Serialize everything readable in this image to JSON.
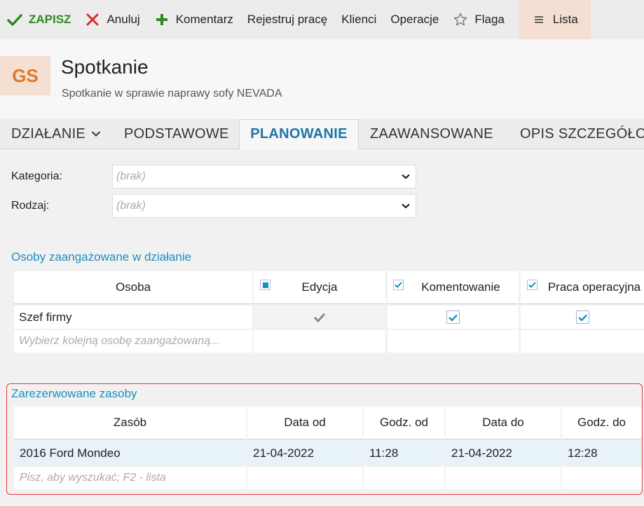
{
  "toolbar": {
    "save": "ZAPISZ",
    "cancel": "Anuluj",
    "comment": "Komentarz",
    "register_work": "Rejestruj pracę",
    "clients": "Klienci",
    "operations": "Operacje",
    "flag": "Flaga",
    "list": "Lista"
  },
  "header": {
    "avatar": "GS",
    "title": "Spotkanie",
    "subtitle": "Spotkanie w sprawie naprawy sofy NEVADA"
  },
  "tabs": [
    {
      "label": "DZIAŁANIE"
    },
    {
      "label": "PODSTAWOWE"
    },
    {
      "label": "PLANOWANIE"
    },
    {
      "label": "ZAAWANSOWANE"
    },
    {
      "label": "OPIS SZCZEGÓŁOWY"
    }
  ],
  "form": {
    "category_label": "Kategoria:",
    "category_value": "(brak)",
    "type_label": "Rodzaj:",
    "type_value": "(brak)"
  },
  "people": {
    "title": "Osoby zaangażowane w działanie",
    "columns": [
      "Osoba",
      "Edycja",
      "Komentowanie",
      "Praca operacyjna"
    ],
    "rows": [
      {
        "person": "Szef firmy",
        "edit": true,
        "comment": true,
        "operational": true
      }
    ],
    "placeholder": "Wybierz kolejną osobę zaangażowaną..."
  },
  "resources": {
    "title": "Zarezerwowane zasoby",
    "columns": [
      "Zasób",
      "Data od",
      "Godz. od",
      "Data do",
      "Godz. do"
    ],
    "rows": [
      {
        "resource": "2016 Ford Mondeo",
        "date_from": "21-04-2022",
        "time_from": "11:28",
        "date_to": "21-04-2022",
        "time_to": "12:28"
      }
    ],
    "placeholder": "Pisz, aby wyszukać; F2 - lista"
  },
  "colors": {
    "accent": "#1d74a8",
    "save_green": "#2d8a1e",
    "cancel_red": "#d32f2f",
    "highlight_frame": "#e53935",
    "avatar_bg": "#f5dfd3",
    "avatar_text": "#e07a2a"
  }
}
